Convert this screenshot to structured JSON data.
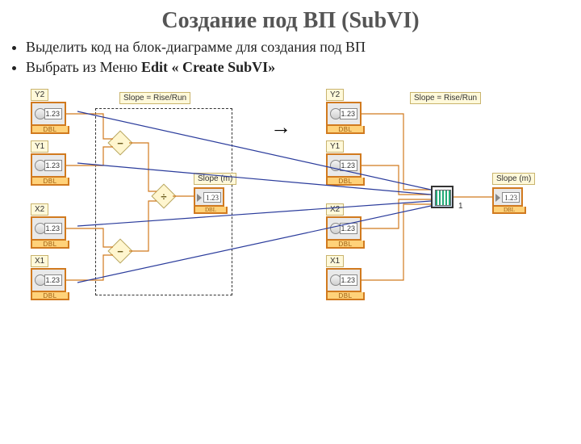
{
  "title": "Создание под ВП (SubVI)",
  "bullets": [
    {
      "plain": "Выделить код на блок-диаграмме  для создания под ВП",
      "bold": ""
    },
    {
      "plain": "Выбрать из  Меню ",
      "bold": "Edit « Create SubVI»"
    }
  ],
  "labels": {
    "slope_formula": "Slope = Rise/Run",
    "slope_m": "Slope (m)",
    "y2": "Y2",
    "y1": "Y1",
    "x2": "X2",
    "x1": "X1"
  },
  "numval": "1.23",
  "dbl": "DBL",
  "ops": {
    "minus": "−",
    "divide": "÷"
  },
  "arrow": "→",
  "subvi_index": "1"
}
